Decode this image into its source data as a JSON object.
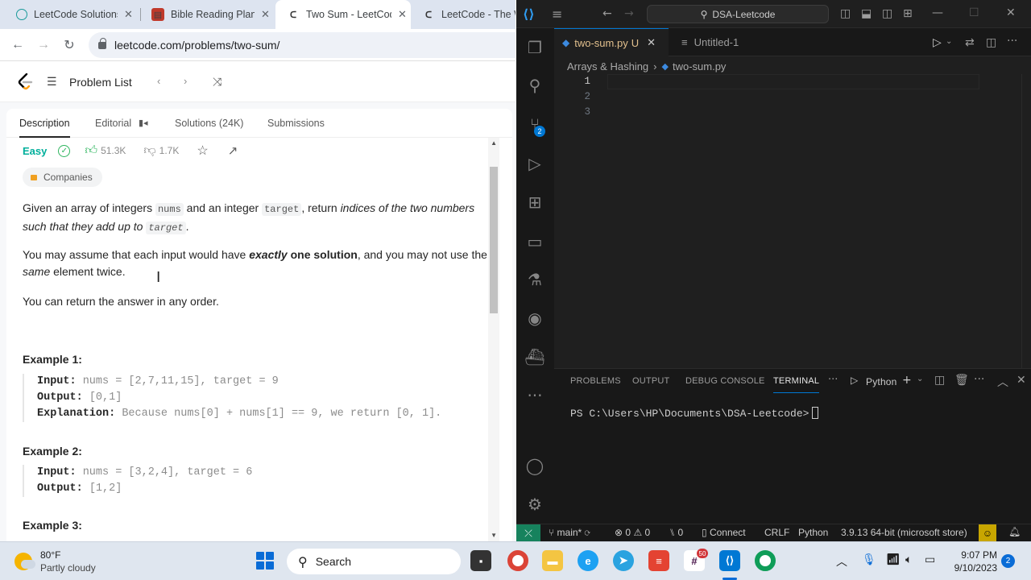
{
  "browser": {
    "tabs": [
      {
        "label": "LeetCode Solutions",
        "icon": "globe-icon"
      },
      {
        "label": "Bible Reading Plan",
        "icon": "bible-icon"
      },
      {
        "label": "Two Sum - LeetCode",
        "icon": "leetcode-icon"
      },
      {
        "label": "LeetCode - The W",
        "icon": "leetcode-icon"
      }
    ],
    "url": "leetcode.com/problems/two-sum/"
  },
  "leetcode": {
    "nav": {
      "problem_list": "Problem List"
    },
    "tabs": {
      "description": "Description",
      "editorial": "Editorial",
      "solutions": "Solutions (24K)",
      "submissions": "Submissions"
    },
    "difficulty": "Easy",
    "likes": "51.3K",
    "dislikes": "1.7K",
    "companies": "Companies",
    "p1": {
      "a": "Given an array of integers ",
      "nums": "nums",
      "b": " and an integer ",
      "target": "target",
      "c": ", return ",
      "d": "indices of the two numbers such that they add up to ",
      "target2": "target",
      "e": "."
    },
    "p2": {
      "a": "You may assume that each input would have ",
      "b": "exactly",
      "c": " one solution",
      "d": ", and you may not use the ",
      "e": "same",
      "f": " element twice."
    },
    "p3": "You can return the answer in any order.",
    "examples": [
      {
        "title": "Example 1:",
        "input_label": "Input:",
        "input": " nums = [2,7,11,15], target = 9",
        "output_label": "Output:",
        "output": " [0,1]",
        "explanation_label": "Explanation:",
        "explanation": " Because nums[0] + nums[1] == 9, we return [0, 1]."
      },
      {
        "title": "Example 2:",
        "input_label": "Input:",
        "input": " nums = [3,2,4], target = 6",
        "output_label": "Output:",
        "output": " [1,2]"
      },
      {
        "title": "Example 3:"
      }
    ]
  },
  "vscode": {
    "search": "DSA-Leetcode",
    "tabs": [
      {
        "label": "two-sum.py",
        "status": "U"
      },
      {
        "label": "Untitled-1"
      }
    ],
    "breadcrumb": {
      "folder": "Arrays & Hashing",
      "file": "two-sum.py"
    },
    "line_numbers": [
      "1",
      "2",
      "3"
    ],
    "scm_badge": "2",
    "panel_tabs": [
      "PROBLEMS",
      "OUTPUT",
      "DEBUG CONSOLE",
      "TERMINAL"
    ],
    "terminal_profile": "Python",
    "terminal_prompt": "PS C:\\Users\\HP\\Documents\\DSA-Leetcode>",
    "status": {
      "branch": "main*",
      "errors": "0",
      "warnings": "0",
      "ports": "0",
      "connect": "Connect",
      "eol": "CRLF",
      "language": "Python",
      "interpreter": "3.9.13 64-bit (microsoft store)"
    }
  },
  "taskbar": {
    "weather_temp": "80°F",
    "weather_desc": "Partly cloudy",
    "search": "Search",
    "slack_badge": "50",
    "time": "9:07 PM",
    "date": "9/10/2023",
    "notifications": "2"
  }
}
